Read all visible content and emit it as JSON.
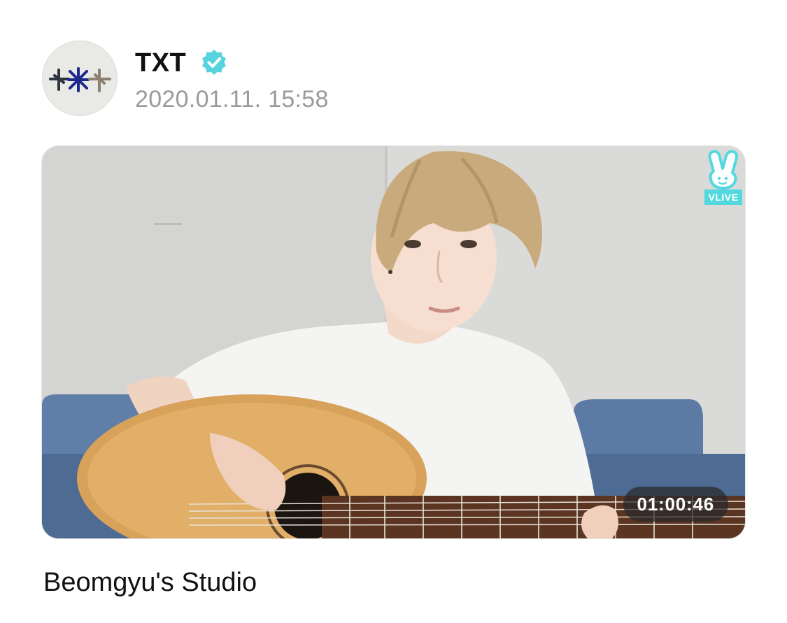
{
  "post": {
    "author": "TXT",
    "verified": true,
    "timestamp": "2020.01.11. 15:58",
    "title": "Beomgyu's Studio"
  },
  "avatar": {
    "icon": "txt-logo-icon"
  },
  "video": {
    "duration": "01:00:46",
    "badge_label": "VLIVE",
    "badge_icon": "vlive-peace-hand-icon"
  },
  "colors": {
    "verified": "#56d3dd",
    "vlive": "#54d8e0",
    "timestamp": "#9a9a9a",
    "text": "#111111"
  }
}
